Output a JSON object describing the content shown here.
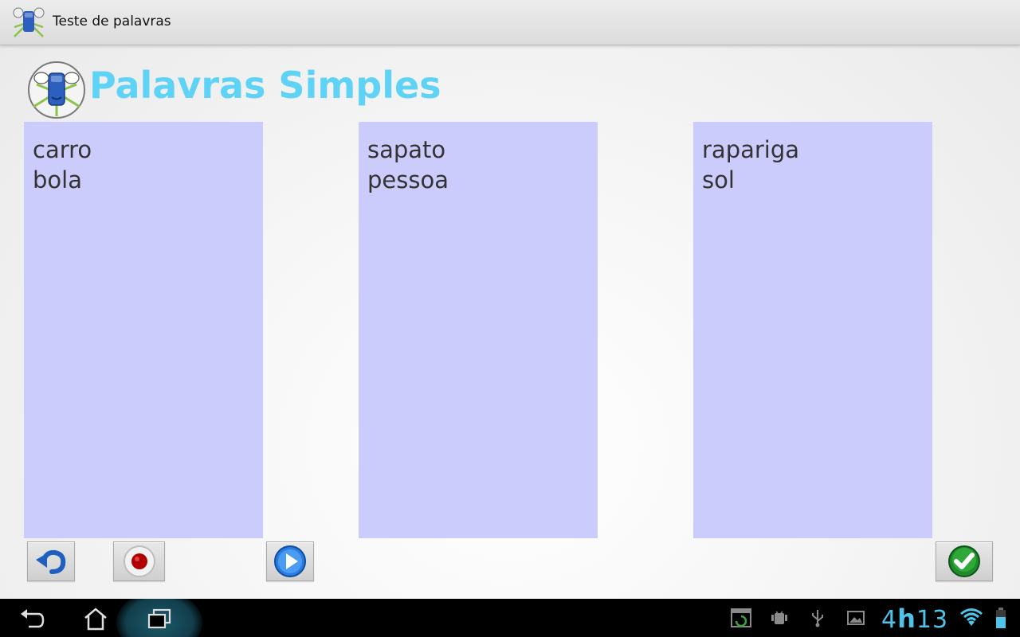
{
  "app": {
    "window_title": "Teste de palavras",
    "app_icon": "app-mascot-icon"
  },
  "header": {
    "title": "Palavras Simples",
    "logo": "mascot-logo-icon",
    "title_color": "#5fd3f5"
  },
  "columns": [
    {
      "words": [
        "carro",
        "bola"
      ]
    },
    {
      "words": [
        "sapato",
        "pessoa"
      ]
    },
    {
      "words": [
        "rapariga",
        "sol"
      ]
    }
  ],
  "column_color": "#ccccfc",
  "toolbar": {
    "undo": {
      "icon": "undo-arrow-icon"
    },
    "record": {
      "icon": "record-icon"
    },
    "play": {
      "icon": "play-icon"
    },
    "confirm": {
      "icon": "checkmark-icon"
    }
  },
  "system_bar": {
    "clock_hours": "4",
    "clock_sep": "h",
    "clock_minutes": "13",
    "clock_color": "#4fc3e8",
    "nav_icons": [
      "back-icon",
      "home-icon",
      "recent-apps-icon"
    ],
    "status_icons": [
      "screenshot-icon",
      "android-debug-icon",
      "usb-icon",
      "gallery-icon",
      "wifi-icon",
      "battery-icon"
    ]
  }
}
